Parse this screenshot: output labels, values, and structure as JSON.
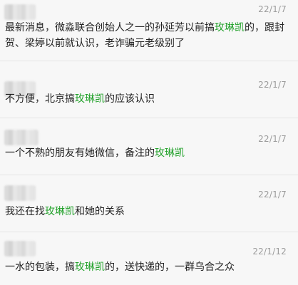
{
  "comments": [
    {
      "date": "22/1/7",
      "parts": [
        "最新消息，微淼联合创始人之一的孙延芳以前搞",
        "玫琳凯",
        "的，跟封贺、梁婷以前就认识，老诈骗元老级别了"
      ]
    },
    {
      "date": "22/1/7",
      "parts": [
        "不方便，北京搞",
        "玫琳凯",
        "的应该认识"
      ]
    },
    {
      "date": "22/1/7",
      "parts": [
        "一个不熟的朋友有她微信，备注的",
        "玫琳凯",
        ""
      ]
    },
    {
      "date": "22/1/7",
      "parts": [
        "我还在找",
        "玫琳凯",
        "和她的关系"
      ]
    },
    {
      "date": "22/1/12",
      "parts": [
        "一水的包装，搞",
        "玫琳凯",
        "的，送快递的，一群乌合之众"
      ]
    }
  ],
  "colors": {
    "highlight": "#22a12a",
    "background": "#f7f7f7",
    "date": "#9b9b9b"
  }
}
